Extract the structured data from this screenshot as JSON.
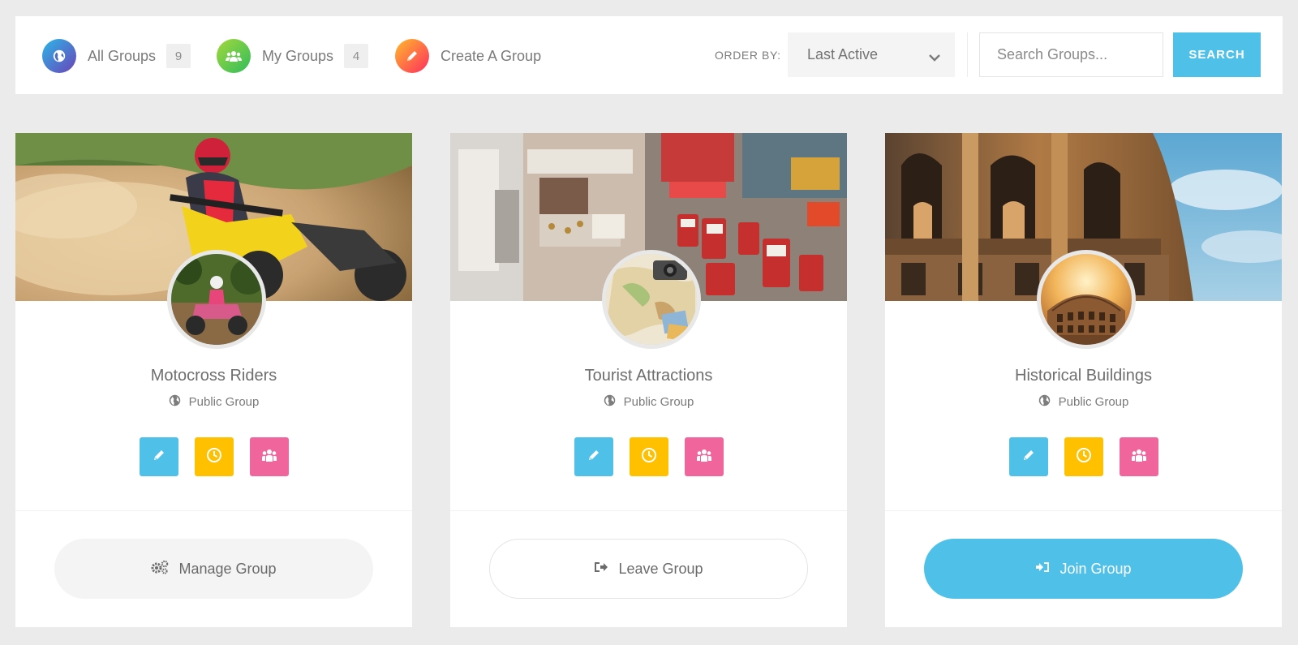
{
  "nav": {
    "tabs": [
      {
        "label": "All Groups",
        "count": "9",
        "icon": "globe-icon"
      },
      {
        "label": "My Groups",
        "count": "4",
        "icon": "users-icon"
      },
      {
        "label": "Create A Group",
        "icon": "pencil-icon"
      }
    ]
  },
  "filter": {
    "order_by_label": "ORDER BY:",
    "order_by_value": "Last Active",
    "search_placeholder": "Search Groups...",
    "search_button": "SEARCH"
  },
  "groups": [
    {
      "name": "Motocross Riders",
      "privacy": "Public Group",
      "action": "Manage Group",
      "action_icon": "gears-icon"
    },
    {
      "name": "Tourist Attractions",
      "privacy": "Public Group",
      "action": "Leave Group",
      "action_icon": "sign-out-icon"
    },
    {
      "name": "Historical Buildings",
      "privacy": "Public Group",
      "action": "Join Group",
      "action_icon": "sign-in-icon"
    }
  ],
  "colors": {
    "accent_blue": "#4fc1e9",
    "accent_yellow": "#ffc000",
    "accent_pink": "#f0659b"
  }
}
